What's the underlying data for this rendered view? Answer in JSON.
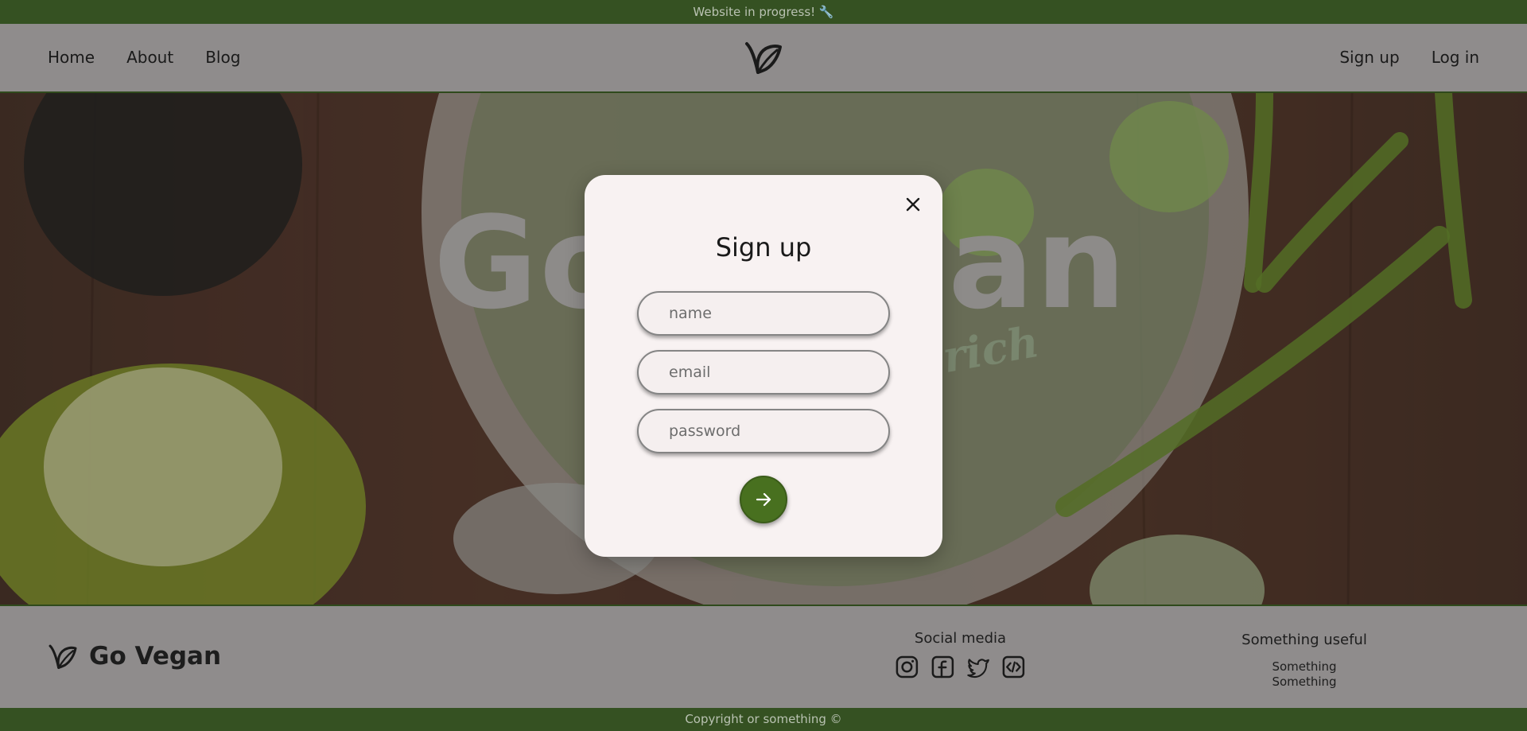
{
  "banner": {
    "text": "Website in progress! 🔧"
  },
  "header": {
    "nav_left": [
      {
        "label": "Home"
      },
      {
        "label": "About"
      },
      {
        "label": "Blog"
      }
    ],
    "nav_right": [
      {
        "label": "Sign up"
      },
      {
        "label": "Log in"
      }
    ],
    "logo_icon": "leaf-logo-icon"
  },
  "hero": {
    "title": "Go Vegan",
    "subtitle": "rich"
  },
  "modal": {
    "title": "Sign up",
    "fields": [
      {
        "placeholder": "name",
        "value": ""
      },
      {
        "placeholder": "email",
        "value": ""
      },
      {
        "placeholder": "password",
        "value": ""
      }
    ],
    "close_icon": "close-icon",
    "submit_icon": "arrow-right-icon"
  },
  "footer": {
    "brand": "Go Vegan",
    "social_title": "Social media",
    "social_icons": [
      "instagram-icon",
      "facebook-icon",
      "twitter-icon",
      "code-icon"
    ],
    "useful_title": "Something useful",
    "useful_links": [
      {
        "label": "Something"
      },
      {
        "label": "Something"
      }
    ]
  },
  "copyright": {
    "text": "Copyright or something ©"
  },
  "colors": {
    "accent_green": "#48701f",
    "bar_green": "#355122",
    "overlay_gray": "#8f8c8c",
    "modal_bg": "#f8f2f2"
  }
}
